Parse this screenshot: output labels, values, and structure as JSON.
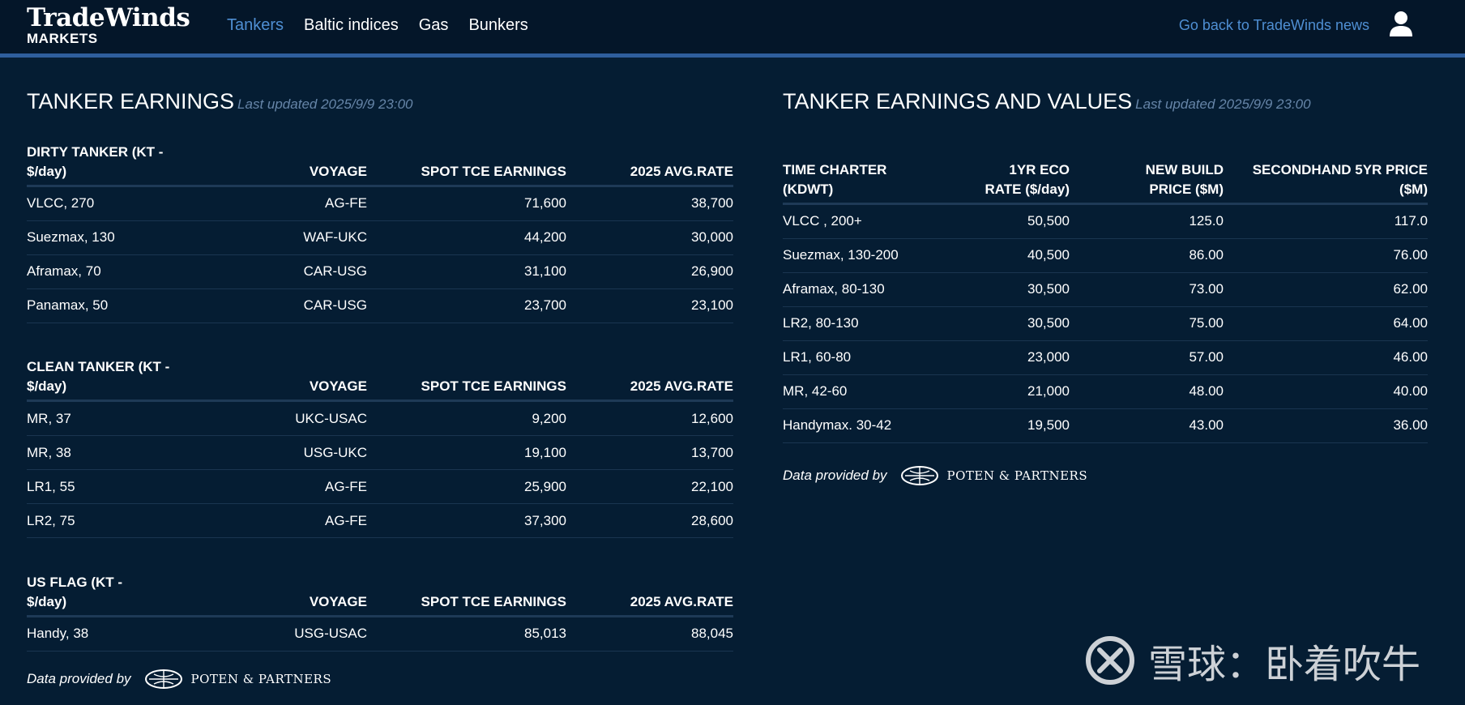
{
  "header": {
    "logo_main": "TradeWinds",
    "logo_sub": "MARKETS",
    "nav": [
      "Tankers",
      "Baltic indices",
      "Gas",
      "Bunkers"
    ],
    "back_link": "Go back to TradeWinds news"
  },
  "left": {
    "title": "TANKER EARNINGS",
    "updated": "Last updated 2025/9/9 23:00",
    "sections": [
      {
        "headers": [
          "DIRTY TANKER (KT - $/day)",
          "VOYAGE",
          "SPOT TCE EARNINGS",
          "2025 AVG.RATE"
        ],
        "rows": [
          [
            "VLCC, 270",
            "AG-FE",
            "71,600",
            "38,700"
          ],
          [
            "Suezmax, 130",
            "WAF-UKC",
            "44,200",
            "30,000"
          ],
          [
            "Aframax, 70",
            "CAR-USG",
            "31,100",
            "26,900"
          ],
          [
            "Panamax, 50",
            "CAR-USG",
            "23,700",
            "23,100"
          ]
        ]
      },
      {
        "headers": [
          "CLEAN TANKER (KT - $/day)",
          "VOYAGE",
          "SPOT TCE EARNINGS",
          "2025 AVG.RATE"
        ],
        "rows": [
          [
            "MR, 37",
            "UKC-USAC",
            "9,200",
            "12,600"
          ],
          [
            "MR, 38",
            "USG-UKC",
            "19,100",
            "13,700"
          ],
          [
            "LR1, 55",
            "AG-FE",
            "25,900",
            "22,100"
          ],
          [
            "LR2, 75",
            "AG-FE",
            "37,300",
            "28,600"
          ]
        ]
      },
      {
        "headers": [
          "US FLAG (KT - $/day)",
          "VOYAGE",
          "SPOT TCE EARNINGS",
          "2025 AVG.RATE"
        ],
        "rows": [
          [
            "Handy, 38",
            "USG-USAC",
            "85,013",
            "88,045"
          ]
        ]
      }
    ],
    "provided_by": "Data provided by",
    "partner": "POTEN & PARTNERS"
  },
  "right": {
    "title": "TANKER EARNINGS AND VALUES",
    "updated": "Last updated 2025/9/9 23:00",
    "headers": [
      "TIME CHARTER (KDWT)",
      "1YR ECO RATE ($/day)",
      "NEW BUILD PRICE ($M)",
      "SECONDHAND 5YR PRICE ($M)"
    ],
    "rows": [
      [
        "VLCC , 200+",
        "50,500",
        "125.0",
        "117.0"
      ],
      [
        "Suezmax, 130-200",
        "40,500",
        "86.00",
        "76.00"
      ],
      [
        "Aframax, 80-130",
        "30,500",
        "73.00",
        "62.00"
      ],
      [
        "LR2, 80-130",
        "30,500",
        "75.00",
        "64.00"
      ],
      [
        "LR1, 60-80",
        "23,000",
        "57.00",
        "46.00"
      ],
      [
        "MR, 42-60",
        "21,000",
        "48.00",
        "40.00"
      ],
      [
        "Handymax. 30-42",
        "19,500",
        "43.00",
        "36.00"
      ]
    ],
    "provided_by": "Data provided by",
    "partner": "POTEN & PARTNERS"
  },
  "watermark": {
    "text": "雪球：卧着吹牛"
  },
  "colors": {
    "background": "#051d33",
    "topbar": "#041629",
    "accent_bar": "#2f5e9c",
    "link": "#4f8fd3",
    "updated_text": "#6685a8"
  }
}
